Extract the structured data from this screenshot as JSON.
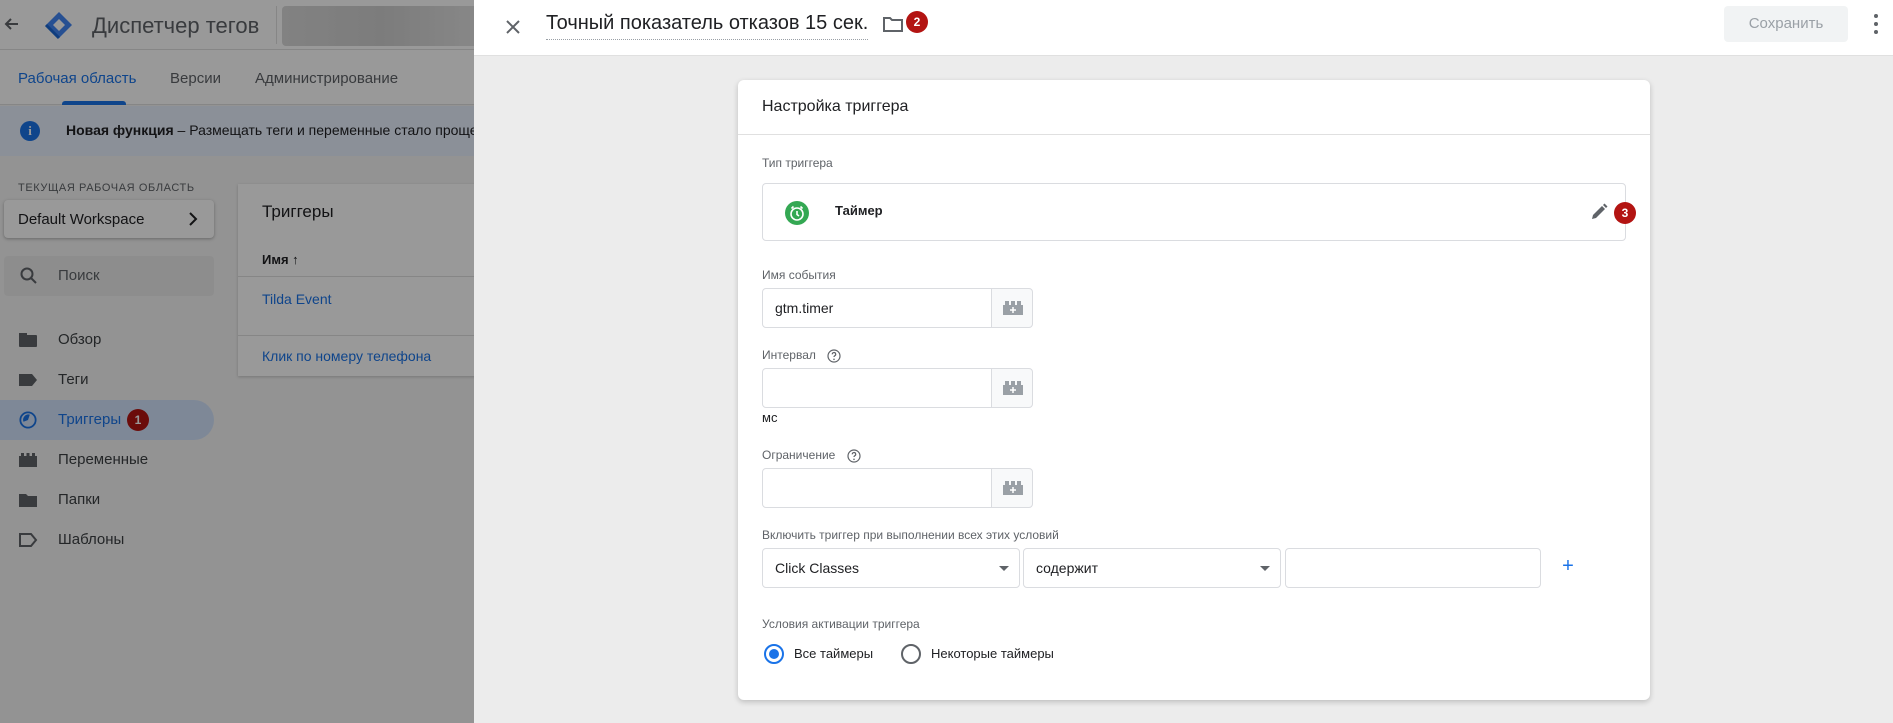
{
  "app": {
    "title": "Диспетчер тегов",
    "tabs": [
      "Рабочая область",
      "Версии",
      "Администрирование"
    ],
    "notice": {
      "bold": "Новая функция",
      "text": " – Размещать теги и переменные стало проще с п"
    },
    "workspace": {
      "label": "ТЕКУЩАЯ РАБОЧАЯ ОБЛАСТЬ",
      "name": "Default Workspace"
    },
    "search_placeholder": "Поиск",
    "sidebar": [
      {
        "label": "Обзор",
        "icon": "overview-icon"
      },
      {
        "label": "Теги",
        "icon": "tag-icon"
      },
      {
        "label": "Триггеры",
        "icon": "trigger-icon",
        "active": true,
        "badge": "1"
      },
      {
        "label": "Переменные",
        "icon": "variable-icon"
      },
      {
        "label": "Папки",
        "icon": "folder-icon"
      },
      {
        "label": "Шаблоны",
        "icon": "template-icon"
      }
    ],
    "triggers_card": {
      "title": "Триггеры",
      "column": "Имя ↑",
      "rows": [
        "Tilda Event",
        "Клик по номеру телефона"
      ]
    }
  },
  "panel": {
    "title": "Точный показатель отказов 15 сек.",
    "folder_badge": "2",
    "save_label": "Сохранить",
    "card_title": "Настройка триггера",
    "trigger_type_label": "Тип триггера",
    "trigger_type": "Таймер",
    "edit_badge": "3",
    "event_name_label": "Имя события",
    "event_name_value": "gtm.timer",
    "interval_label": "Интервал",
    "interval_value": "",
    "interval_unit": "мс",
    "limit_label": "Ограничение",
    "limit_value": "",
    "conditions_label": "Включить триггер при выполнении всех этих условий",
    "condition": {
      "variable": "Click Classes",
      "operator": "содержит",
      "value": ""
    },
    "activation_label": "Условия активации триггера",
    "radio_all": "Все таймеры",
    "radio_some": "Некоторые таймеры",
    "radio_selected": "all"
  },
  "colors": {
    "accent": "#1a73e8",
    "badge": "#b31412",
    "timer_icon": "#34a853"
  }
}
